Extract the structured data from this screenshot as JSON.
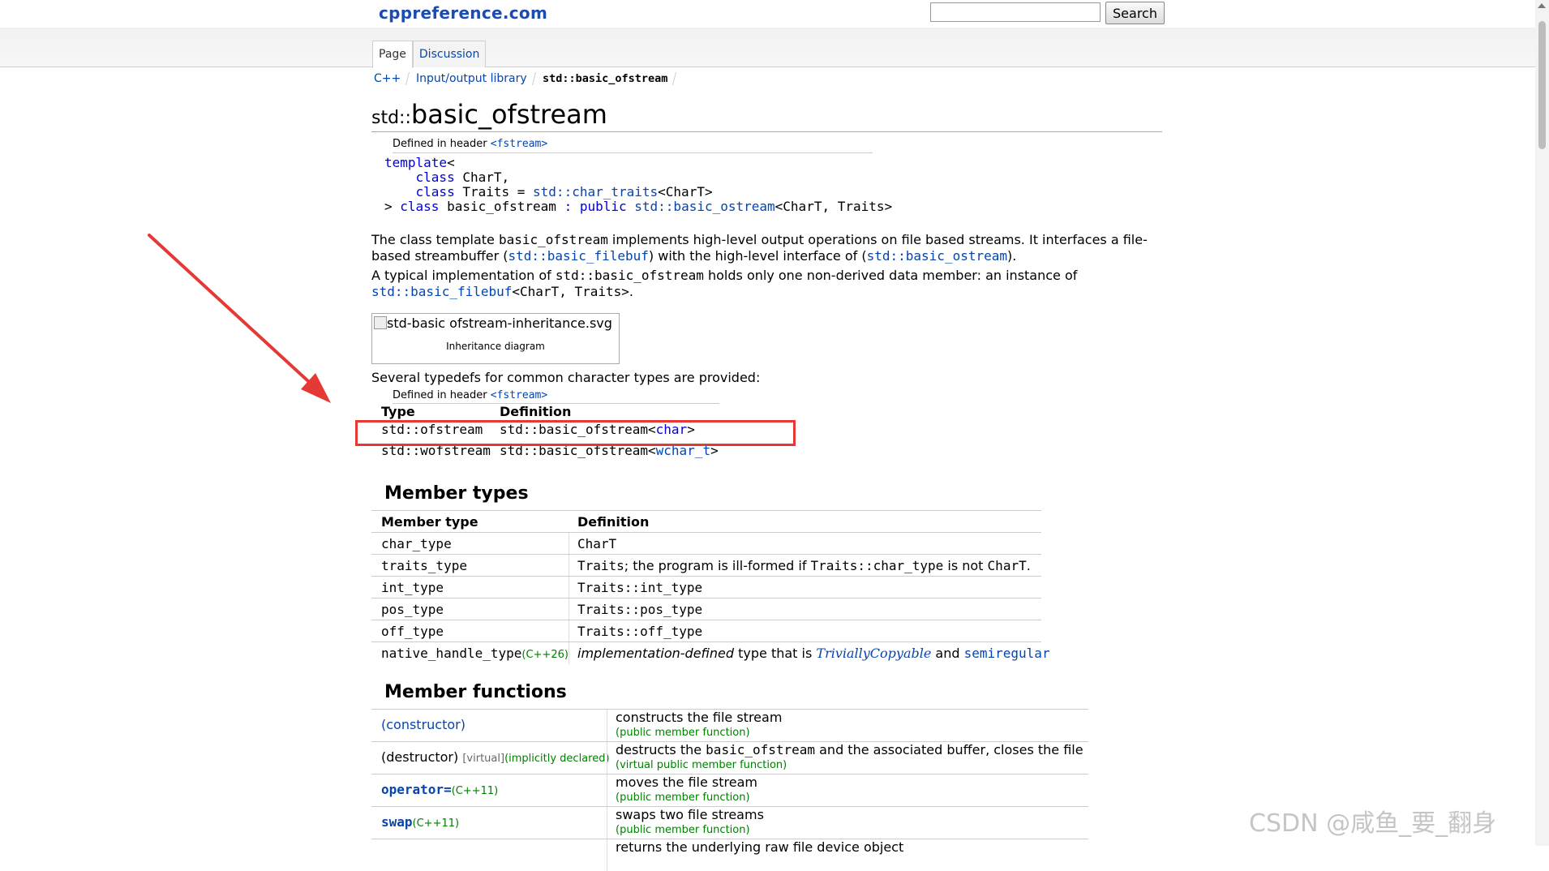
{
  "header": {
    "site_title": "cppreference.com",
    "search_value": "",
    "search_button": "Search",
    "tabs": [
      "Page",
      "Discussion"
    ]
  },
  "breadcrumb": [
    "C++",
    "Input/output library",
    "std::basic_ofstream"
  ],
  "page": {
    "title_ns": "std::",
    "title_name": "basic_ofstream",
    "defined_in": "Defined in header",
    "header_name": "<fstream>",
    "declaration": {
      "l1_kw": "template",
      "l1_rest": "<",
      "l2_kw": "class",
      "l2_rest": " CharT,",
      "l3_kw": "class",
      "l3_mid": " Traits = ",
      "l3_link": "std::char_traits",
      "l3_rest": "<CharT>",
      "l4_a": "> ",
      "l4_kw": "class",
      "l4_b": " basic_ofstream ",
      "l4_c": ": ",
      "l4_pub": "public",
      "l4_sp": " ",
      "l4_link": "std::basic_ostream",
      "l4_rest": "<CharT, Traits>"
    },
    "para1": {
      "a": "The class template ",
      "b": "basic_ofstream",
      "c": " implements high-level output operations on file based streams. It interfaces a file-based streambuffer (",
      "d": "std::basic_filebuf",
      "e": ") with the high-level interface of (",
      "f": "std::basic_ostream",
      "g": ")."
    },
    "para2": {
      "a": "A typical implementation of ",
      "b": "std::basic_ofstream",
      "c": " holds only one non-derived data member: an instance of ",
      "d": "std::basic_filebuf",
      "e": "<CharT, Traits>",
      "f": "."
    },
    "diagram_alt": "std-basic ofstream-inheritance.svg",
    "diagram_caption": "Inheritance diagram",
    "para3": "Several typedefs for common character types are provided:",
    "typedefs": {
      "col_type": "Type",
      "col_def": "Definition",
      "rows": [
        {
          "type": "std::ofstream",
          "def_base": "std::basic_ofstream<",
          "def_arg": "char",
          "def_end": ">"
        },
        {
          "type": "std::wofstream",
          "def_base": "std::basic_ofstream<",
          "def_arg": "wchar_t",
          "def_end": ">"
        }
      ]
    },
    "member_types": {
      "heading": "Member types",
      "col1": "Member type",
      "col2": "Definition",
      "rows": [
        {
          "name": "char_type",
          "def": "CharT"
        },
        {
          "name": "traits_type",
          "def_a": "Traits",
          "def_b": "; the program is ill-formed if ",
          "def_c": "Traits::char_type",
          "def_d": " is not ",
          "def_e": "CharT",
          "def_f": "."
        },
        {
          "name": "int_type",
          "def": "Traits::int_type"
        },
        {
          "name": "pos_type",
          "def": "Traits::pos_type"
        },
        {
          "name": "off_type",
          "def": "Traits::off_type"
        },
        {
          "name": "native_handle_type",
          "badge": "(C++26)",
          "def_a": "implementation-defined",
          "def_b": " type that is ",
          "def_c": "TriviallyCopyable",
          "def_d": " and ",
          "def_e": "semiregular"
        }
      ]
    },
    "member_functions": {
      "heading": "Member functions",
      "rows": [
        {
          "name": "(constructor)",
          "desc": "constructs the file stream",
          "note": "(public member function)"
        },
        {
          "name": "(destructor)",
          "tag1": "[virtual]",
          "tag2": "(implicitly declared)",
          "desc_a": "destructs the ",
          "desc_b": "basic_ofstream",
          "desc_c": " and the associated buffer, closes the file",
          "note": "(virtual public member function)"
        },
        {
          "name": "operator=",
          "badge": "(C++11)",
          "desc": "moves the file stream",
          "note": "(public member function)"
        },
        {
          "name": "swap",
          "badge": "(C++11)",
          "desc": "swaps two file streams",
          "note": "(public member function)"
        },
        {
          "desc": "returns the underlying raw file device object"
        }
      ]
    }
  },
  "watermark": "CSDN @咸鱼_要_翻身",
  "colors": {
    "link": "#0645ad",
    "keyword": "#0000dd",
    "badge": "#008000",
    "highlight_box": "#e53935",
    "arrow": "#e53935"
  }
}
